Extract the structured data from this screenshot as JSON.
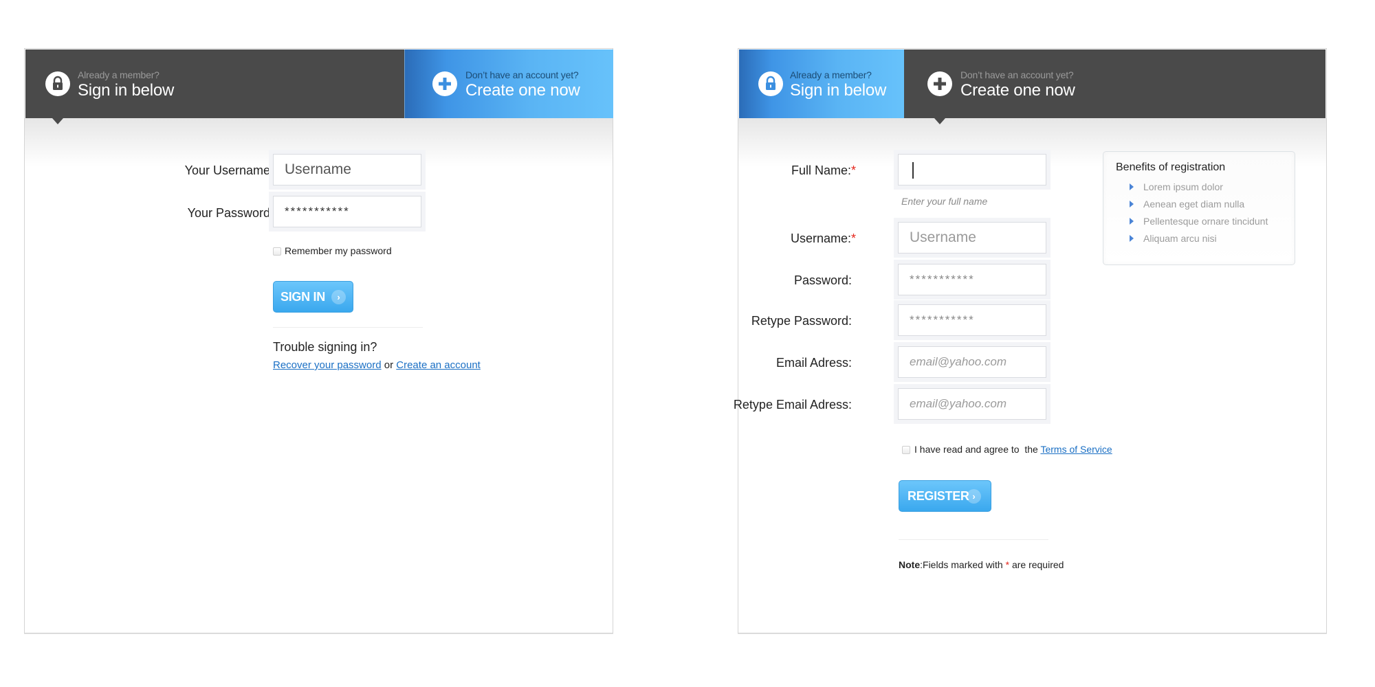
{
  "login_card": {
    "tabs": [
      {
        "sub": "Already a member?",
        "main": "Sign in below",
        "icon": "lock-icon",
        "active": false
      },
      {
        "sub": "Don’t have an account yet?",
        "main": "Create one now",
        "icon": "plus-icon",
        "active": true
      }
    ],
    "username_label": "Your Username:",
    "username_value": "Username",
    "password_label": "Your Password:",
    "password_value": "***********",
    "remember_label": "Remember my password",
    "signin_button": "SIGN IN",
    "trouble_heading": "Trouble signing in?",
    "recover_link": "Recover your password",
    "or_text": "or",
    "create_link": "Create an account"
  },
  "register_card": {
    "tabs": [
      {
        "sub": "Already a member?",
        "main": "Sign in below",
        "icon": "lock-icon",
        "active": true
      },
      {
        "sub": "Don’t have an account yet?",
        "main": "Create one now",
        "icon": "plus-icon",
        "active": false
      }
    ],
    "fields": [
      {
        "label": "Full Name:",
        "required": true,
        "value": "",
        "placeholder": ""
      },
      {
        "label": "Username:",
        "required": true,
        "value": "",
        "placeholder": "Username"
      },
      {
        "label": "Password:",
        "required": false,
        "value": "***********",
        "placeholder": ""
      },
      {
        "label": "Retype Password:",
        "required": false,
        "value": "***********",
        "placeholder": ""
      },
      {
        "label": "Email Adress:",
        "required": false,
        "value": "",
        "placeholder": "email@yahoo.com"
      },
      {
        "label": "Retype Email Adress:",
        "required": false,
        "value": "",
        "placeholder": "email@yahoo.com"
      }
    ],
    "required_mark": "*",
    "fullname_hint": "Enter your full name",
    "terms_text": "I have read and agree to  the",
    "terms_link": "Terms of Service",
    "register_button": "REGISTER",
    "note_bold": "Note",
    "note_text_1": ":Fields marked with ",
    "note_star": "*",
    "note_text_2": " are required",
    "benefits": {
      "title": "Benefits of registration",
      "items": [
        "Lorem ipsum dolor",
        "Aenean eget diam nulla",
        "Pellentesque ornare tincidunt",
        "Aliquam arcu nisi"
      ]
    }
  },
  "colors": {
    "header_dark": "#4a4a4a",
    "accent_blue": "#3aa8ee",
    "link_blue": "#1a6fc4",
    "required_red": "#e4261c"
  }
}
